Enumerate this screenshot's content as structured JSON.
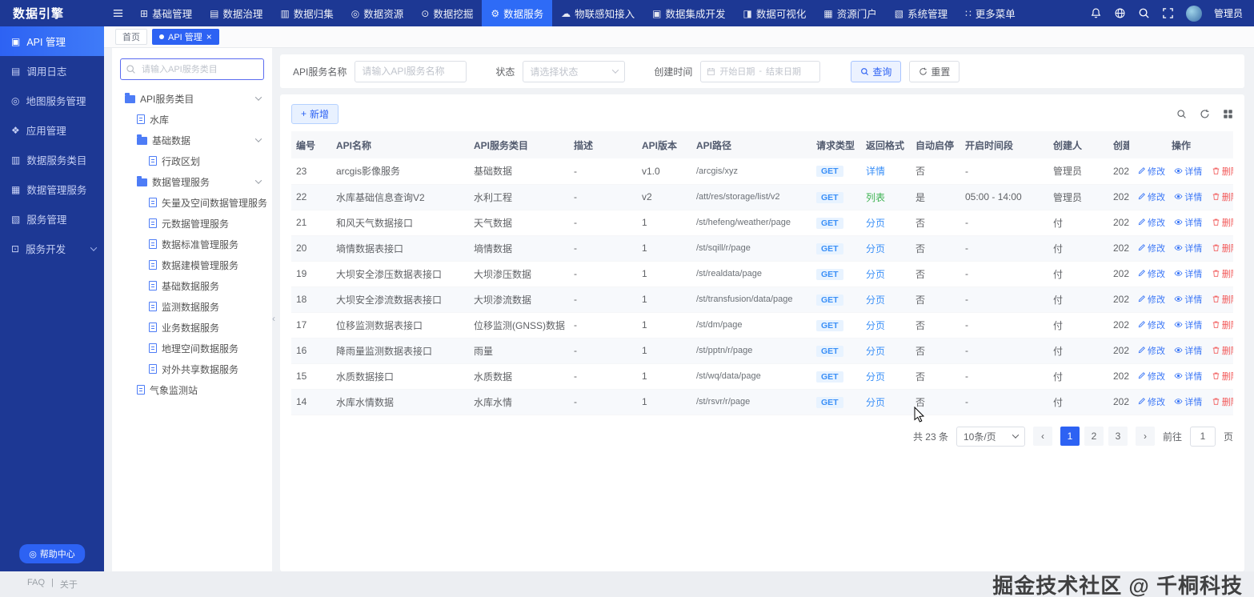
{
  "colors": {
    "primary": "#2d62f3",
    "topbar": "#1d3894",
    "success": "#3eb352",
    "danger": "#f25a5a"
  },
  "topbar": {
    "logo": "数据引擎",
    "nav": [
      {
        "label": "基础管理",
        "icon": "grid-icon"
      },
      {
        "label": "数据治理",
        "icon": "book-icon"
      },
      {
        "label": "数据归集",
        "icon": "collect-icon"
      },
      {
        "label": "数据资源",
        "icon": "resource-icon"
      },
      {
        "label": "数据挖掘",
        "icon": "mining-icon"
      },
      {
        "label": "数据服务",
        "icon": "gear-icon",
        "active": true
      },
      {
        "label": "物联感知接入",
        "icon": "cloud-icon"
      },
      {
        "label": "数据集成开发",
        "icon": "integrate-icon"
      },
      {
        "label": "数据可视化",
        "icon": "visual-icon"
      },
      {
        "label": "资源门户",
        "icon": "portal-icon"
      },
      {
        "label": "系统管理",
        "icon": "system-icon"
      },
      {
        "label": "更多菜单",
        "icon": "more-icon"
      }
    ],
    "user": "管理员"
  },
  "sidebar": {
    "items": [
      {
        "label": "API 管理",
        "icon": "api-icon",
        "active": true
      },
      {
        "label": "调用日志",
        "icon": "log-icon"
      },
      {
        "label": "地图服务管理",
        "icon": "map-icon"
      },
      {
        "label": "应用管理",
        "icon": "app-icon"
      },
      {
        "label": "数据服务类目",
        "icon": "category-icon"
      },
      {
        "label": "数据管理服务",
        "icon": "database-icon"
      },
      {
        "label": "服务管理",
        "icon": "service-icon"
      },
      {
        "label": "服务开发",
        "icon": "dev-icon",
        "expandable": true
      }
    ],
    "help": "帮助中心",
    "faq": "FAQ",
    "divider": "|",
    "about": "关于"
  },
  "tabs": [
    {
      "label": "首页"
    },
    {
      "label": "API 管理",
      "active": true
    }
  ],
  "tree": {
    "search_placeholder": "请输入API服务类目",
    "items": [
      {
        "label": "API服务类目",
        "depth": 0,
        "type": "folder",
        "expanded": true
      },
      {
        "label": "水库",
        "depth": 1,
        "type": "doc"
      },
      {
        "label": "基础数据",
        "depth": 1,
        "type": "folder",
        "expanded": true
      },
      {
        "label": "行政区划",
        "depth": 2,
        "type": "doc"
      },
      {
        "label": "数据管理服务",
        "depth": 1,
        "type": "folder",
        "expanded": true
      },
      {
        "label": "矢量及空间数据管理服务",
        "depth": 2,
        "type": "doc"
      },
      {
        "label": "元数据管理服务",
        "depth": 2,
        "type": "doc"
      },
      {
        "label": "数据标准管理服务",
        "depth": 2,
        "type": "doc"
      },
      {
        "label": "数据建模管理服务",
        "depth": 2,
        "type": "doc"
      },
      {
        "label": "基础数据服务",
        "depth": 2,
        "type": "doc"
      },
      {
        "label": "监测数据服务",
        "depth": 2,
        "type": "doc"
      },
      {
        "label": "业务数据服务",
        "depth": 2,
        "type": "doc"
      },
      {
        "label": "地理空间数据服务",
        "depth": 2,
        "type": "doc"
      },
      {
        "label": "对外共享数据服务",
        "depth": 2,
        "type": "doc"
      },
      {
        "label": "气象监测站",
        "depth": 1,
        "type": "doc"
      }
    ]
  },
  "filters": {
    "name_label": "API服务名称",
    "name_placeholder": "请输入API服务名称",
    "status_label": "状态",
    "status_placeholder": "请选择状态",
    "date_label": "创建时间",
    "date_start": "开始日期",
    "date_sep": "-",
    "date_end": "结束日期",
    "search_label": "查询",
    "reset_label": "重置"
  },
  "toolbar": {
    "add_label": "新增"
  },
  "glyphs": {
    "plus": "+",
    "close": "×",
    "collapse": "‹"
  },
  "table": {
    "columns": [
      "编号",
      "API名称",
      "API服务类目",
      "描述",
      "API版本",
      "API路径",
      "请求类型",
      "返回格式",
      "自动启停",
      "开启时间段",
      "创建人",
      "创建时间",
      "操作"
    ],
    "action_labels": {
      "edit": "修改",
      "detail": "详情",
      "delete": "删除"
    },
    "rows": [
      {
        "id": "23",
        "name": "arcgis影像服务",
        "category": "基础数据",
        "desc": "-",
        "version": "v1.0",
        "path": "/arcgis/xyz",
        "method": "GET",
        "format": "详情",
        "format_type": "primary",
        "auto": "否",
        "period": "-",
        "creator": "管理员",
        "created": "202"
      },
      {
        "id": "22",
        "name": "水库基础信息查询V2",
        "category": "水利工程",
        "desc": "-",
        "version": "v2",
        "path": "/att/res/storage/list/v2",
        "method": "GET",
        "format": "列表",
        "format_type": "success",
        "auto": "是",
        "period": "05:00 - 14:00",
        "creator": "管理员",
        "created": "202"
      },
      {
        "id": "21",
        "name": "和风天气数据接口",
        "category": "天气数据",
        "desc": "-",
        "version": "1",
        "path": "/st/hefeng/weather/page",
        "method": "GET",
        "format": "分页",
        "format_type": "primary",
        "auto": "否",
        "period": "-",
        "creator": "付",
        "created": "202"
      },
      {
        "id": "20",
        "name": "墒情数据表接口",
        "category": "墒情数据",
        "desc": "-",
        "version": "1",
        "path": "/st/sqill/r/page",
        "method": "GET",
        "format": "分页",
        "format_type": "primary",
        "auto": "否",
        "period": "-",
        "creator": "付",
        "created": "202"
      },
      {
        "id": "19",
        "name": "大坝安全渗压数据表接口",
        "category": "大坝渗压数据",
        "desc": "-",
        "version": "1",
        "path": "/st/realdata/page",
        "method": "GET",
        "format": "分页",
        "format_type": "primary",
        "auto": "否",
        "period": "-",
        "creator": "付",
        "created": "202"
      },
      {
        "id": "18",
        "name": "大坝安全渗流数据表接口",
        "category": "大坝渗流数据",
        "desc": "-",
        "version": "1",
        "path": "/st/transfusion/data/page",
        "method": "GET",
        "format": "分页",
        "format_type": "primary",
        "auto": "否",
        "period": "-",
        "creator": "付",
        "created": "202"
      },
      {
        "id": "17",
        "name": "位移监测数据表接口",
        "category": "位移监测(GNSS)数据",
        "desc": "-",
        "version": "1",
        "path": "/st/dm/page",
        "method": "GET",
        "format": "分页",
        "format_type": "primary",
        "auto": "否",
        "period": "-",
        "creator": "付",
        "created": "202"
      },
      {
        "id": "16",
        "name": "降雨量监测数据表接口",
        "category": "雨量",
        "desc": "-",
        "version": "1",
        "path": "/st/pptn/r/page",
        "method": "GET",
        "format": "分页",
        "format_type": "primary",
        "auto": "否",
        "period": "-",
        "creator": "付",
        "created": "202"
      },
      {
        "id": "15",
        "name": "水质数据接口",
        "category": "水质数据",
        "desc": "-",
        "version": "1",
        "path": "/st/wq/data/page",
        "method": "GET",
        "format": "分页",
        "format_type": "primary",
        "auto": "否",
        "period": "-",
        "creator": "付",
        "created": "202"
      },
      {
        "id": "14",
        "name": "水库水情数据",
        "category": "水库水情",
        "desc": "-",
        "version": "1",
        "path": "/st/rsvr/r/page",
        "method": "GET",
        "format": "分页",
        "format_type": "primary",
        "auto": "否",
        "period": "-",
        "creator": "付",
        "created": "202"
      }
    ]
  },
  "pagination": {
    "total": "共 23 条",
    "page_size": "10条/页",
    "prev": "‹",
    "next": "›",
    "pages": [
      "1",
      "2",
      "3"
    ],
    "active_page": "1",
    "goto_label": "前往",
    "goto_value": "1",
    "page_label": "页"
  },
  "watermark": "掘金技术社区 @ 千桐科技"
}
